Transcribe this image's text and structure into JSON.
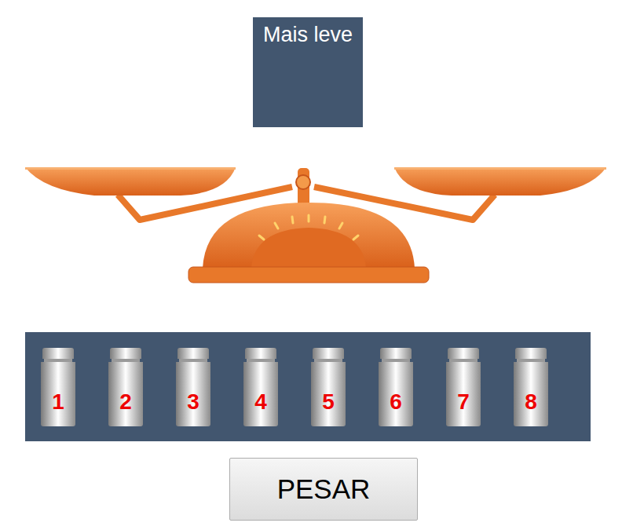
{
  "display": {
    "label": "Mais leve"
  },
  "weights": [
    {
      "label": "1"
    },
    {
      "label": "2"
    },
    {
      "label": "3"
    },
    {
      "label": "4"
    },
    {
      "label": "5"
    },
    {
      "label": "6"
    },
    {
      "label": "7"
    },
    {
      "label": "8"
    }
  ],
  "button": {
    "label": "PESAR"
  }
}
